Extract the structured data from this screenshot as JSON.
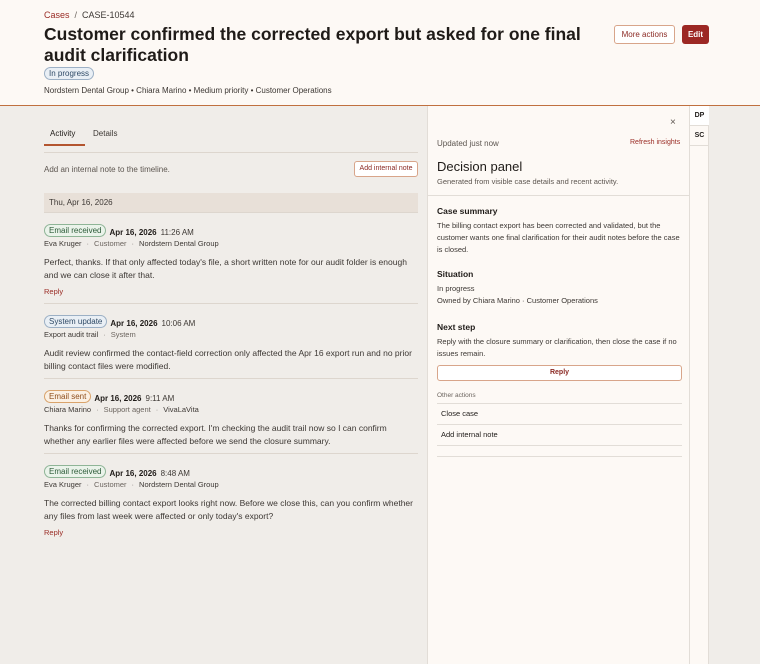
{
  "breadcrumb": {
    "root": "Cases",
    "separator": "/",
    "current": "CASE-10544"
  },
  "case": {
    "title": "Customer confirmed the corrected export but asked for one final audit clarification",
    "status": "In progress",
    "meta": "Nordstern Dental Group • Chiara Marino • Medium priority • Customer Operations"
  },
  "actions": {
    "more": "More actions",
    "edit": "Edit"
  },
  "rail": {
    "tabs": [
      "DP",
      "SC"
    ]
  },
  "tabs": {
    "activity": "Activity",
    "details": "Details"
  },
  "note": {
    "hint": "Add an internal note to the timeline.",
    "button": "Add internal note"
  },
  "date_separator": "Thu, Apr 16, 2026",
  "entries": [
    {
      "type": "Email received",
      "date": "Apr 16, 2026",
      "time": "11:26 AM",
      "author": "Eva Kruger",
      "role": "Customer",
      "org": "Nordstern Dental Group",
      "body": "Perfect, thanks. If that only affected today's file, a short written note for our audit folder is enough and we can close it after that.",
      "reply": "Reply"
    },
    {
      "type": "System update",
      "date": "Apr 16, 2026",
      "time": "10:06 AM",
      "author": "Export audit trail",
      "role": "System",
      "body": "Audit review confirmed the contact-field correction only affected the Apr 16 export run and no prior billing contact files were modified."
    },
    {
      "type": "Email sent",
      "date": "Apr 16, 2026",
      "time": "9:11 AM",
      "author": "Chiara Marino",
      "role": "Support agent",
      "org": "VivaLaVita",
      "body": "Thanks for confirming the corrected export. I'm checking the audit trail now so I can confirm whether any earlier files were affected before we send the closure summary."
    },
    {
      "type": "Email received",
      "date": "Apr 16, 2026",
      "time": "8:48 AM",
      "author": "Eva Kruger",
      "role": "Customer",
      "org": "Nordstern Dental Group",
      "body": "The corrected billing contact export looks right now. Before we close this, can you confirm whether any files from last week were affected or only today's export?",
      "reply": "Reply"
    }
  ],
  "panel": {
    "close": "×",
    "updated": "Updated just now",
    "refresh": "Refresh insights",
    "title": "Decision panel",
    "subtitle": "Generated from visible case details and recent activity.",
    "summary_head": "Case summary",
    "summary": "The billing contact export has been corrected and validated, but the customer wants one final clarification for their audit notes before the case is closed.",
    "situation_head": "Situation",
    "situation_status": "In progress",
    "situation_owner": "Owned by Chiara Marino · Customer Operations",
    "next_head": "Next step",
    "next": "Reply with the closure summary or clarification, then close the case if no issues remain.",
    "reply_button": "Reply",
    "other_head": "Other actions",
    "other_actions": [
      "Close case",
      "Add internal note"
    ]
  }
}
